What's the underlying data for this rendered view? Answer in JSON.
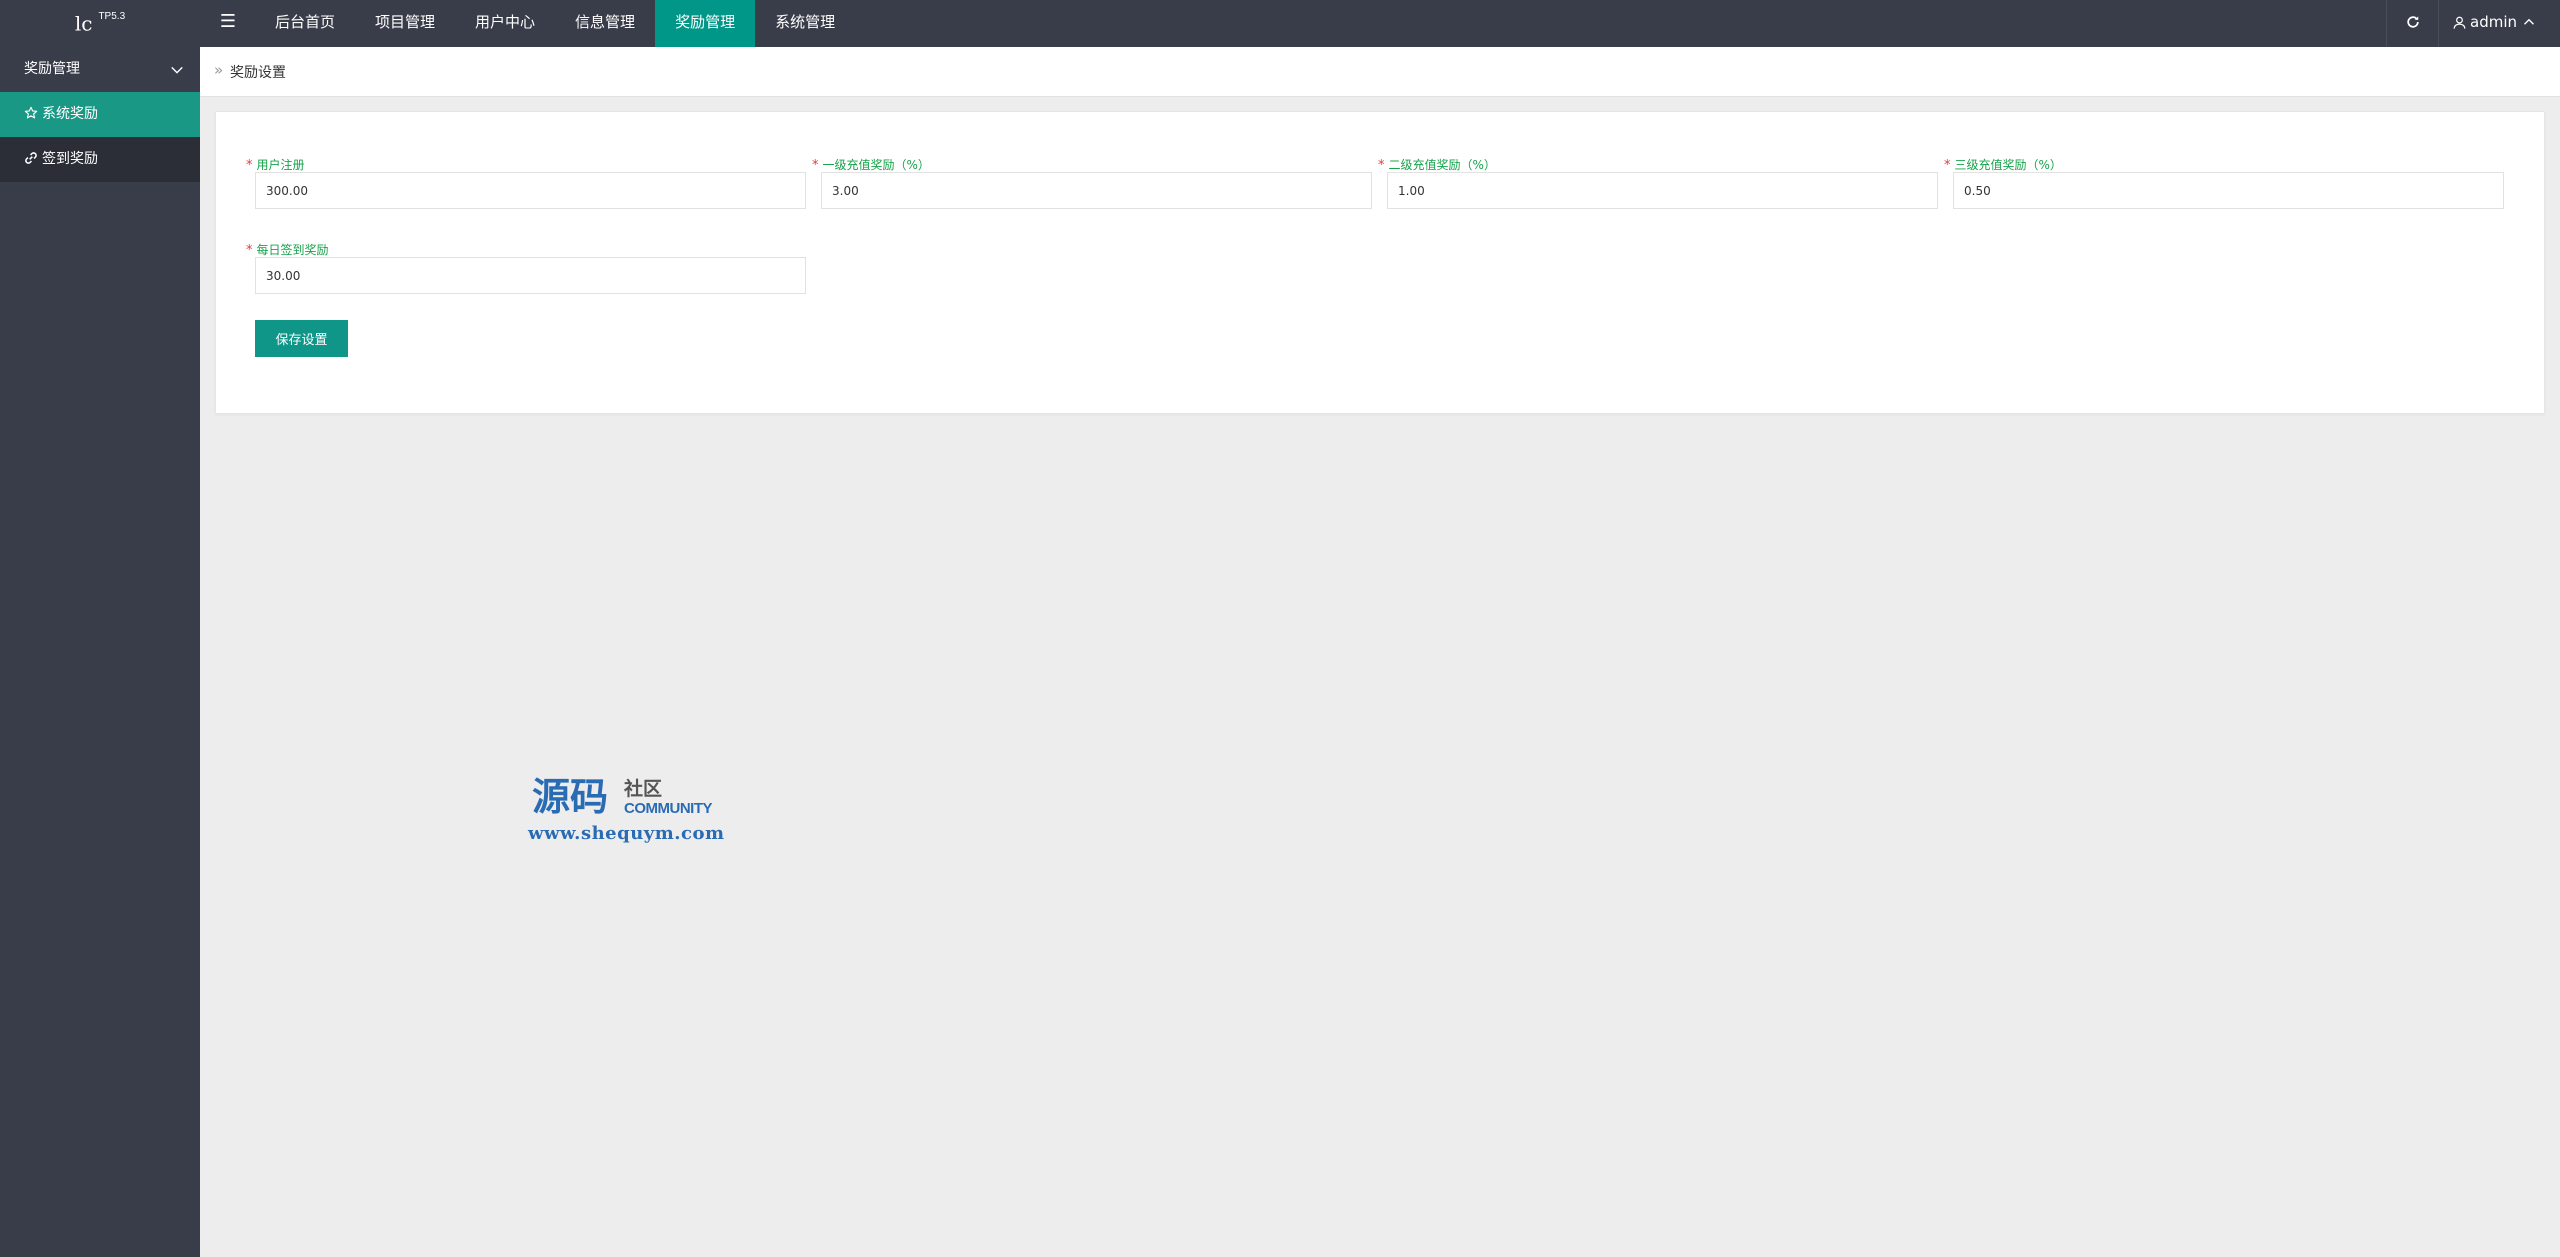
{
  "header": {
    "logo_text": "lc",
    "logo_version": "TP5.3",
    "nav": [
      {
        "label": "后台首页",
        "active": false
      },
      {
        "label": "项目管理",
        "active": false
      },
      {
        "label": "用户中心",
        "active": false
      },
      {
        "label": "信息管理",
        "active": false
      },
      {
        "label": "奖励管理",
        "active": true
      },
      {
        "label": "系统管理",
        "active": false
      }
    ],
    "user_name": "admin"
  },
  "sidebar": {
    "group_label": "奖励管理",
    "items": [
      {
        "label": "系统奖励",
        "icon": "star-icon",
        "active": true
      },
      {
        "label": "签到奖励",
        "icon": "link-icon",
        "active": false
      }
    ]
  },
  "breadcrumb": {
    "current": "奖励设置"
  },
  "form": {
    "fields": [
      {
        "label": "用户注册",
        "value": "300.00"
      },
      {
        "label": "一级充值奖励（%）",
        "value": "3.00"
      },
      {
        "label": "二级充值奖励（%）",
        "value": "1.00"
      },
      {
        "label": "三级充值奖励（%）",
        "value": "0.50"
      },
      {
        "label": "每日签到奖励",
        "value": "30.00"
      }
    ],
    "save_label": "保存设置"
  },
  "watermark": {
    "main": "源码",
    "sub": "社区",
    "community": "COMMUNITY",
    "url": "www.shequym.com"
  },
  "colors": {
    "header_bg": "#393d49",
    "accent": "#009688",
    "label_green": "#16a34a",
    "required_red": "#e53935"
  }
}
